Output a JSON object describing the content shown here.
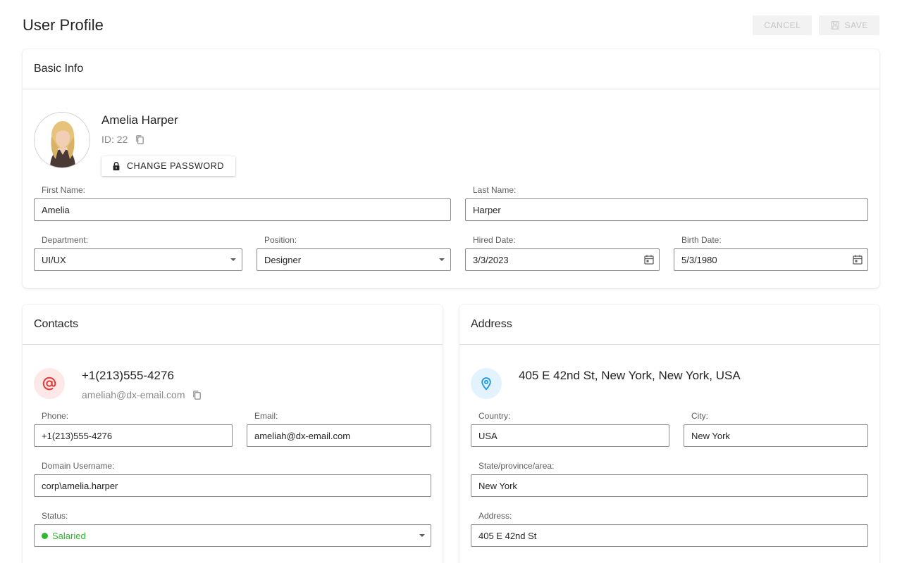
{
  "header": {
    "title": "User Profile",
    "cancel_label": "CANCEL",
    "save_label": "SAVE"
  },
  "basic_info": {
    "title": "Basic Info",
    "name": "Amelia Harper",
    "id_text": "ID: 22",
    "change_password_label": "CHANGE PASSWORD",
    "first_name": {
      "label": "First Name:",
      "value": "Amelia"
    },
    "last_name": {
      "label": "Last Name:",
      "value": "Harper"
    },
    "department": {
      "label": "Department:",
      "value": "UI/UX"
    },
    "position": {
      "label": "Position:",
      "value": "Designer"
    },
    "hired_date": {
      "label": "Hired Date:",
      "value": "3/3/2023"
    },
    "birth_date": {
      "label": "Birth Date:",
      "value": "5/3/1980"
    }
  },
  "contacts": {
    "title": "Contacts",
    "phone_display": "+1(213)555-4276",
    "email_display": "ameliah@dx-email.com",
    "phone": {
      "label": "Phone:",
      "value": "+1(213)555-4276"
    },
    "email": {
      "label": "Email:",
      "value": "ameliah@dx-email.com"
    },
    "domain_username": {
      "label": "Domain Username:",
      "value": "corp\\amelia.harper"
    },
    "status": {
      "label": "Status:",
      "value": "Salaried",
      "color": "#2eb82e"
    }
  },
  "address": {
    "title": "Address",
    "full_address": "405 E 42nd St, New York, New York, USA",
    "country": {
      "label": "Country:",
      "value": "USA"
    },
    "city": {
      "label": "City:",
      "value": "New York"
    },
    "state": {
      "label": "State/province/area:",
      "value": "New York"
    },
    "address": {
      "label": "Address:",
      "value": "405 E 42nd St"
    }
  },
  "colors": {
    "email_icon_bg": "#fde8e8",
    "email_icon": "#e53935",
    "location_icon_bg": "#e3f3fd",
    "location_icon": "#1e9be0"
  }
}
